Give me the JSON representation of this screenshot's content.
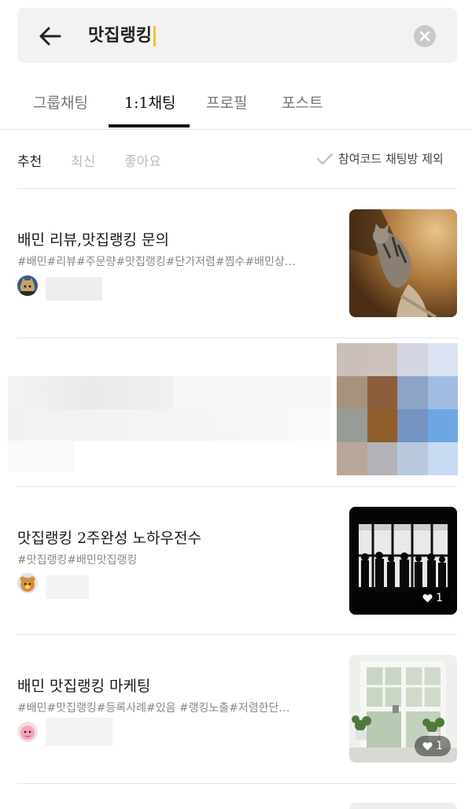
{
  "search": {
    "query": "맛집랭킹"
  },
  "tabs": [
    {
      "label": "그룹채팅"
    },
    {
      "label": "1:1채팅"
    },
    {
      "label": "프로필"
    },
    {
      "label": "포스트"
    }
  ],
  "sort": {
    "options": [
      {
        "label": "추천"
      },
      {
        "label": "최신"
      },
      {
        "label": "좋아요"
      }
    ],
    "exclude_label": "참여코드 채팅방 제외"
  },
  "results": [
    {
      "title": "배민 리뷰,맛집랭킹 문의",
      "tags": "#배민#리뷰#주문량#맛집랭킹#단가저렴#찜수#배민상…"
    },
    {
      "title": "맛집랭킹 2주완성 노하우전수",
      "tags": "#맛집랭킹#배민맛집랭킹",
      "likes": "1"
    },
    {
      "title": "배민 맛집랭킹 마케팅",
      "tags": "#배민#맛집랭킹#등록사례#있음 #랭킹노출#저렴한단…",
      "likes": "1"
    }
  ],
  "colors": {
    "caret": "#f5c518",
    "active": "#111111",
    "inactive": "#bdbdbd"
  }
}
